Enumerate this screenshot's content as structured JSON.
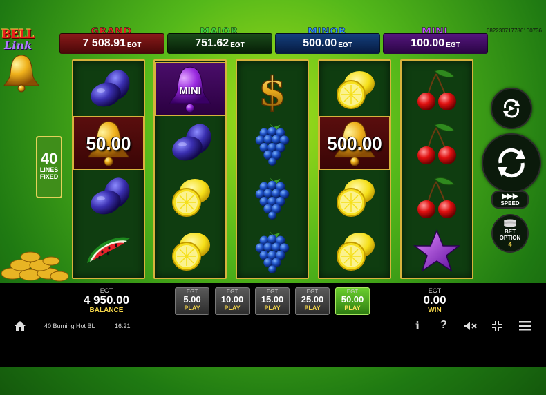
{
  "logo": {
    "line1": "BELL",
    "line2": "Link"
  },
  "jackpots": [
    {
      "name": "GRAND",
      "value": "7 508.91",
      "unit": "EGT",
      "name_color": "#e22222",
      "box_color": "#6b0f0f"
    },
    {
      "name": "MAJOR",
      "value": "751.62",
      "unit": "EGT",
      "name_color": "#3ed43e",
      "box_color": "#0e3a0e"
    },
    {
      "name": "MINOR",
      "value": "500.00",
      "unit": "EGT",
      "name_color": "#2f8eff",
      "box_color": "#0b2a5e"
    },
    {
      "name": "MINI",
      "value": "100.00",
      "unit": "EGT",
      "name_color": "#c050ff",
      "box_color": "#3b0c5c"
    }
  ],
  "game_id": "682230717786100736",
  "lines": {
    "count": "40",
    "label1": "LINES",
    "label2": "FIXED"
  },
  "reels": [
    [
      "plum",
      "bell:50.00",
      "plum",
      "watermelon"
    ],
    [
      "bell:MINI",
      "plum",
      "lemon",
      "lemon"
    ],
    [
      "dollar",
      "grapes",
      "grapes",
      "grapes"
    ],
    [
      "lemon",
      "bell:500.00",
      "lemon",
      "lemon"
    ],
    [
      "cherries",
      "cherries",
      "cherries",
      "star"
    ]
  ],
  "bell_values": {
    "r1": "50.00",
    "r2": "MINI",
    "r4": "500.00"
  },
  "buttons": {
    "speed": "SPEED",
    "bet_option": "BET",
    "bet_option2": "OPTION",
    "bet_option_value": "4"
  },
  "balance": {
    "currency": "EGT",
    "value": "4 950.00",
    "label": "BALANCE"
  },
  "bets": [
    {
      "currency": "EGT",
      "value": "5.00",
      "label": "PLAY"
    },
    {
      "currency": "EGT",
      "value": "10.00",
      "label": "PLAY"
    },
    {
      "currency": "EGT",
      "value": "15.00",
      "label": "PLAY"
    },
    {
      "currency": "EGT",
      "value": "25.00",
      "label": "PLAY"
    },
    {
      "currency": "EGT",
      "value": "50.00",
      "label": "PLAY",
      "active": true
    }
  ],
  "win": {
    "currency": "EGT",
    "value": "0.00",
    "label": "WIN"
  },
  "status": {
    "game_title": "40 Burning Hot BL",
    "clock": "16:21"
  },
  "icons": [
    "home-icon",
    "info-icon",
    "help-icon",
    "mute-icon",
    "fullscreen-exit-icon",
    "menu-icon"
  ]
}
